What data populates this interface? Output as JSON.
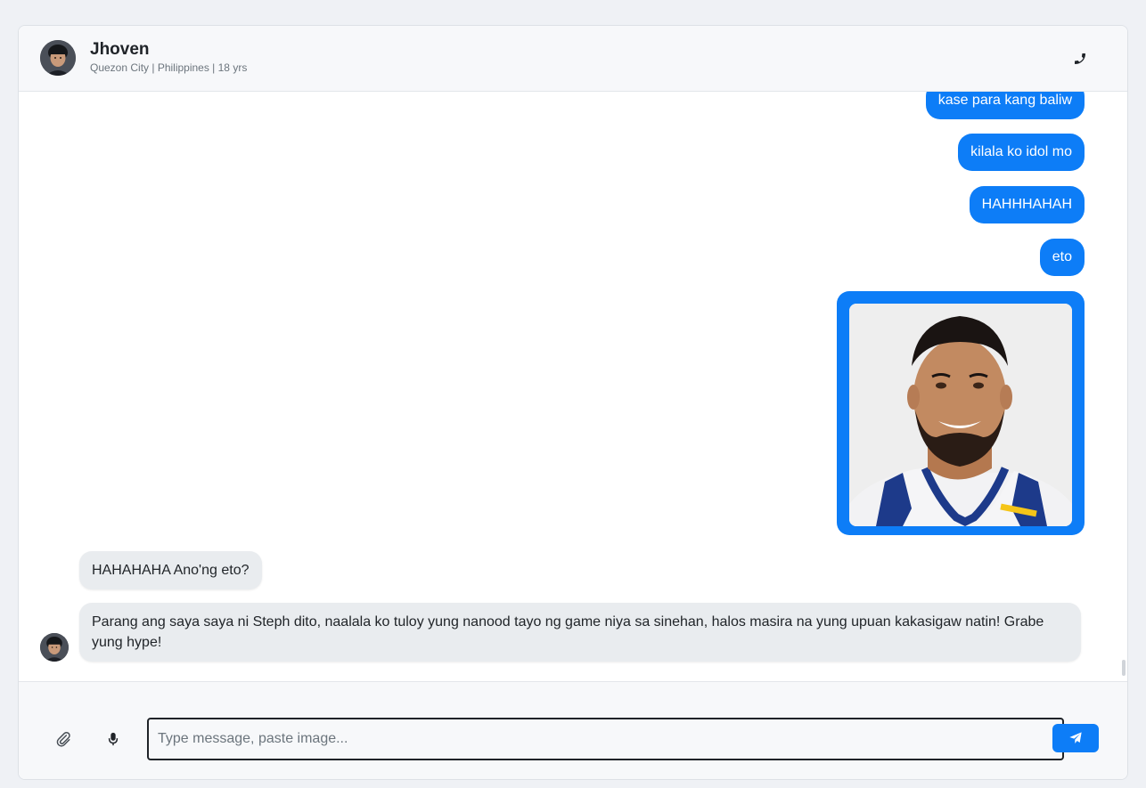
{
  "contact": {
    "name": "Jhoven",
    "meta": "Quezon City | Philippines | 18 yrs"
  },
  "messages": {
    "outgoing": [
      "kase para kang baliw",
      "kilala ko idol mo",
      "HAHHHAHAH",
      "eto"
    ],
    "incoming": [
      "HAHAHAHA Ano'ng eto?",
      "Parang ang saya saya ni Steph dito, naalala ko tuloy yung nanood tayo ng game niya sa sinehan, halos masira na yung upuan kakasigaw natin! Grabe yung hype!"
    ]
  },
  "composer": {
    "placeholder": "Type message, paste image..."
  },
  "colors": {
    "accent": "#0d7df7",
    "incoming_bubble": "#e9ecef",
    "background": "#eff1f5"
  },
  "icons": {
    "call": "phone-icon",
    "attach": "paperclip-icon",
    "voice": "microphone-icon",
    "send": "paper-plane-icon"
  }
}
